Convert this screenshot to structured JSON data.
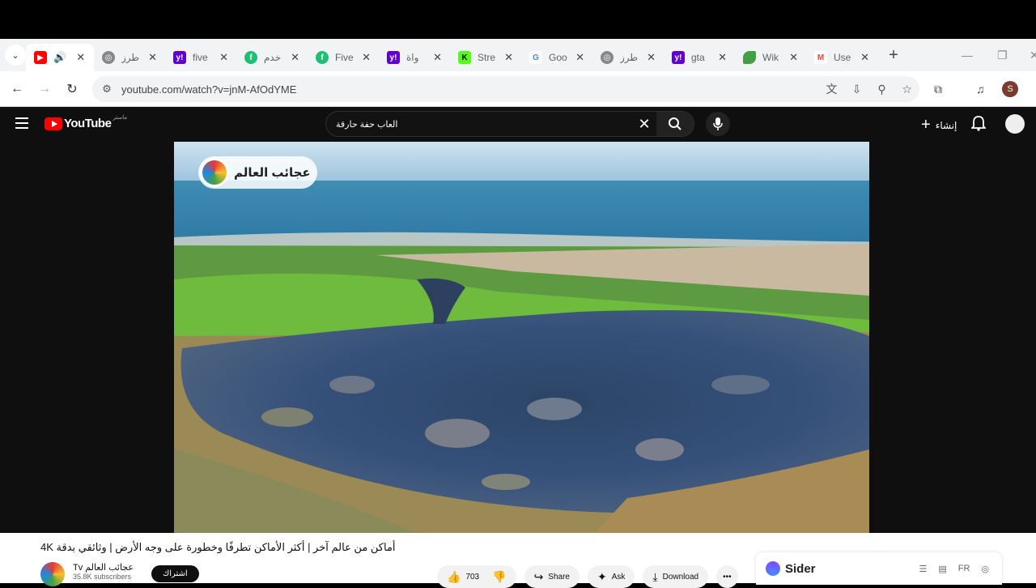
{
  "browser": {
    "tabs": [
      {
        "title": "",
        "favicon": "youtube-icon",
        "color": "#ff0000",
        "active": true
      },
      {
        "title": "طرز",
        "favicon": "globe-icon",
        "color": "#888888"
      },
      {
        "title": "five",
        "favicon": "yahoo-icon",
        "color": "#6001d2"
      },
      {
        "title": "خدم",
        "favicon": "fiverr-icon",
        "color": "#1dbf73"
      },
      {
        "title": "Five",
        "favicon": "fiverr-icon",
        "color": "#1dbf73"
      },
      {
        "title": "واة",
        "favicon": "yahoo-icon",
        "color": "#6001d2"
      },
      {
        "title": "Stre",
        "favicon": "kick-icon",
        "color": "#53fc18"
      },
      {
        "title": "Goo",
        "favicon": "google-icon",
        "color": "#4285f4"
      },
      {
        "title": "طرز",
        "favicon": "globe-icon",
        "color": "#888888"
      },
      {
        "title": "gta",
        "favicon": "yahoo-icon",
        "color": "#6001d2"
      },
      {
        "title": "Wik",
        "favicon": "leaf-icon",
        "color": "#43a047"
      },
      {
        "title": "Use",
        "favicon": "gmail-icon",
        "color": "#ea4335"
      }
    ],
    "url": "youtube.com/watch?v=jnM-AfOdYME",
    "profile_initial": "S"
  },
  "youtube": {
    "logo_text": "YouTube",
    "logo_country": "ماستر",
    "search_value": "العاب حفة حارقة",
    "create_label": "إنشاء",
    "watermark": "عجائب العالم",
    "video": {
      "title": "أماكن من عالم آخر | أكثر الأماكن تطرفًا وخطورة على وجه الأرض | وثائقي بدقة 4K",
      "channel_name": "Tv عجائب العالم",
      "subscribers": "35.8K subscribers",
      "subscribe_label": "اشتراك",
      "likes": "703",
      "share_label": "Share",
      "ask_label": "Ask",
      "download_label": "Download"
    },
    "sider": {
      "name": "Sider",
      "lang": "FR"
    }
  }
}
